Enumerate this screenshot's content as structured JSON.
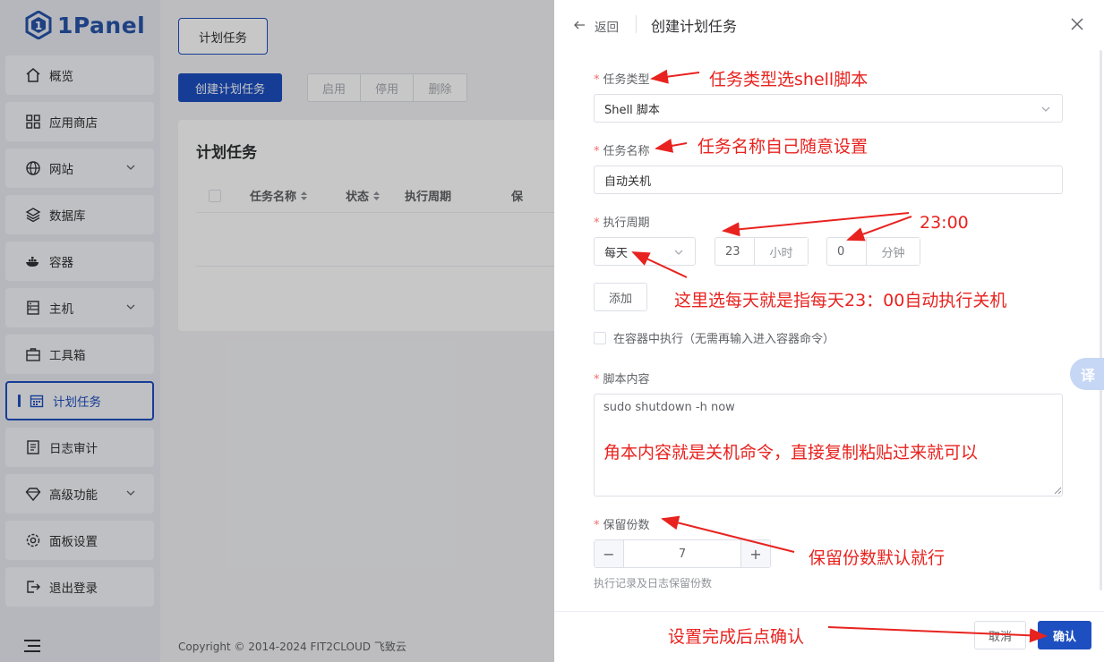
{
  "brand": {
    "name": "1Panel"
  },
  "sidebar": {
    "items": [
      {
        "label": "概览",
        "icon": "home-icon",
        "has_chevron": false
      },
      {
        "label": "应用商店",
        "icon": "apps-grid-icon",
        "has_chevron": false
      },
      {
        "label": "网站",
        "icon": "globe-icon",
        "has_chevron": true
      },
      {
        "label": "数据库",
        "icon": "layers-icon",
        "has_chevron": false
      },
      {
        "label": "容器",
        "icon": "docker-icon",
        "has_chevron": false
      },
      {
        "label": "主机",
        "icon": "server-icon",
        "has_chevron": true
      },
      {
        "label": "工具箱",
        "icon": "toolbox-icon",
        "has_chevron": false
      },
      {
        "label": "计划任务",
        "icon": "calendar-icon",
        "has_chevron": false,
        "active": true
      },
      {
        "label": "日志审计",
        "icon": "log-icon",
        "has_chevron": false
      },
      {
        "label": "高级功能",
        "icon": "diamond-icon",
        "has_chevron": true
      },
      {
        "label": "面板设置",
        "icon": "gear-icon",
        "has_chevron": false
      },
      {
        "label": "退出登录",
        "icon": "logout-icon",
        "has_chevron": false
      }
    ]
  },
  "main": {
    "tab": "计划任务",
    "create_button": "创建计划任务",
    "bulk_actions": [
      "启用",
      "停用",
      "删除"
    ],
    "card_title": "计划任务",
    "columns": [
      "任务名称",
      "状态",
      "执行周期",
      "保"
    ],
    "footer": "Copyright © 2014-2024 FIT2CLOUD 飞致云"
  },
  "drawer": {
    "back": "返回",
    "title": "创建计划任务",
    "task_type": {
      "label": "任务类型",
      "value": "Shell 脚本"
    },
    "task_name": {
      "label": "任务名称",
      "value": "自动关机"
    },
    "schedule": {
      "label": "执行周期",
      "period": "每天",
      "hour": "23",
      "hour_unit": "小时",
      "minute": "0",
      "minute_unit": "分钟",
      "add_button": "添加"
    },
    "in_container": {
      "label": "在容器中执行（无需再输入进入容器命令）",
      "checked": false
    },
    "script": {
      "label": "脚本内容",
      "value": "sudo shutdown -h now"
    },
    "retain": {
      "label": "保留份数",
      "value": "7",
      "help": "执行记录及日志保留份数"
    },
    "cancel": "取消",
    "confirm": "确认",
    "translate": "译"
  },
  "annotations": {
    "task_type": "任务类型选shell脚本",
    "task_name": "任务名称自己随意设置",
    "time": "23:00",
    "period": "这里选每天就是指每天23：00自动执行关机",
    "script": "角本内容就是关机命令，直接复制粘贴过来就可以",
    "retain": "保留份数默认就行",
    "confirm": "设置完成后点确认"
  },
  "colors": {
    "primary": "#1d4fc0",
    "annotation": "#e8231f",
    "required": "#f56c6c"
  }
}
